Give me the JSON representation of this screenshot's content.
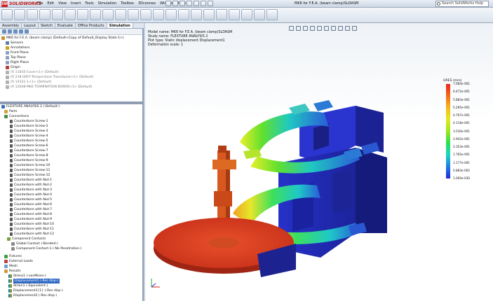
{
  "app": {
    "brand": "SOLIDWORKS",
    "document_title": "MK6 for F.E.A. (beam clamp)SLDASM",
    "search_placeholder": "Search SolidWorks Help"
  },
  "menu": [
    "File",
    "Edit",
    "View",
    "Insert",
    "Tools",
    "Simulation",
    "Toolbox",
    "3Dconnex",
    "Window",
    "Help"
  ],
  "tabs": [
    {
      "label": "Assembly",
      "active": false
    },
    {
      "label": "Layout",
      "active": false
    },
    {
      "label": "Sketch",
      "active": false
    },
    {
      "label": "Evaluate",
      "active": false
    },
    {
      "label": "Office Products",
      "active": false
    },
    {
      "label": "Simulation",
      "active": true
    }
  ],
  "feature_tree_top": [
    {
      "label": "MK6 for F.E.A. (beam clamp) (Default<Copy of Default_Display State-1>)",
      "dim": false,
      "color": "#c98d2a",
      "indent": 0
    },
    {
      "label": "Sensors",
      "dim": false,
      "color": "#5a7fb0",
      "indent": 1
    },
    {
      "label": "Annotations",
      "dim": false,
      "color": "#d0a020",
      "indent": 1
    },
    {
      "label": "Front Plane",
      "dim": false,
      "color": "#8aa0c0",
      "indent": 1
    },
    {
      "label": "Top Plane",
      "dim": false,
      "color": "#8aa0c0",
      "indent": 1
    },
    {
      "label": "Right Plane",
      "dim": false,
      "color": "#8aa0c0",
      "indent": 1
    },
    {
      "label": "Origin",
      "dim": false,
      "color": "#b04040",
      "indent": 1
    },
    {
      "label": "(f) 11835-Cover<1> (Default)",
      "dim": true,
      "color": "#b0b0b0",
      "indent": 1
    },
    {
      "label": "(f) 218-0007-Temperature Transducer<1> (Default)",
      "dim": true,
      "color": "#b0b0b0",
      "indent": 1
    },
    {
      "label": "(f) 14331-1<1> (Default)",
      "dim": true,
      "color": "#b0b0b0",
      "indent": 1
    },
    {
      "label": "(f) 12648-MK6 TERMINATION BOARD<1> (Default)",
      "dim": true,
      "color": "#b0b0b0",
      "indent": 1
    }
  ],
  "study_tree": {
    "root": "FLEXTURE ANALYSIS 2 (-Default-)",
    "parts": "Parts",
    "connections": "Connections",
    "screws": [
      "Counterbore Screw-1",
      "Counterbore Screw-2",
      "Counterbore Screw-3",
      "Counterbore Screw-4",
      "Counterbore Screw-5",
      "Counterbore Screw-6",
      "Counterbore Screw-7",
      "Counterbore Screw-8",
      "Counterbore Screw-9",
      "Counterbore Screw-10",
      "Counterbore Screw-11",
      "Counterbore Screw-12",
      "Counterbore with Nut-1",
      "Counterbore with Nut-2",
      "Counterbore with Nut-3",
      "Counterbore with Nut-4",
      "Counterbore with Nut-5",
      "Counterbore with Nut-6",
      "Counterbore with Nut-7",
      "Counterbore with Nut-8",
      "Counterbore with Nut-9",
      "Counterbore with Nut-10",
      "Counterbore with Nut-11",
      "Counterbore with Nut-12"
    ],
    "component_contacts": "Component Contacts",
    "global_contact": "Global Contact (-Bonded-)",
    "component_contact_1": "Component Contact-1 (-No Penetration-)",
    "fixtures": "Fixtures",
    "external_loads": "External Loads",
    "mesh": "Mesh",
    "results": "Results",
    "result_items": [
      {
        "label": "Stress1 (-vonMises-)",
        "selected": false
      },
      {
        "label": "Displacement1 (-Res disp-)",
        "selected": true
      },
      {
        "label": "Strain1 (-Equivalent-)",
        "selected": false
      },
      {
        "label": "Displacement1{1} (-Res disp-)",
        "selected": false
      },
      {
        "label": "Displacement2 (-Res disp-)",
        "selected": false
      }
    ]
  },
  "plot_info": {
    "model_name": "Model name: MK6 for F.E.A. (beam clamp)SLDASM",
    "study_name": "Study name: FLEXTURE ANALYSIS 2",
    "plot_type": "Plot type: Static displacement Displacement1",
    "deformation": "Deformation scale: 1"
  },
  "legend": {
    "title": "URES (mm)",
    "ticks": [
      "7.060e-001",
      "6.472e-001",
      "5.883e-001",
      "5.295e-001",
      "4.707e-001",
      "4.118e-001",
      "3.530e-001",
      "2.942e-001",
      "2.353e-001",
      "1.765e-001",
      "1.177e-001",
      "5.883e-002",
      "1.000e-030"
    ]
  }
}
